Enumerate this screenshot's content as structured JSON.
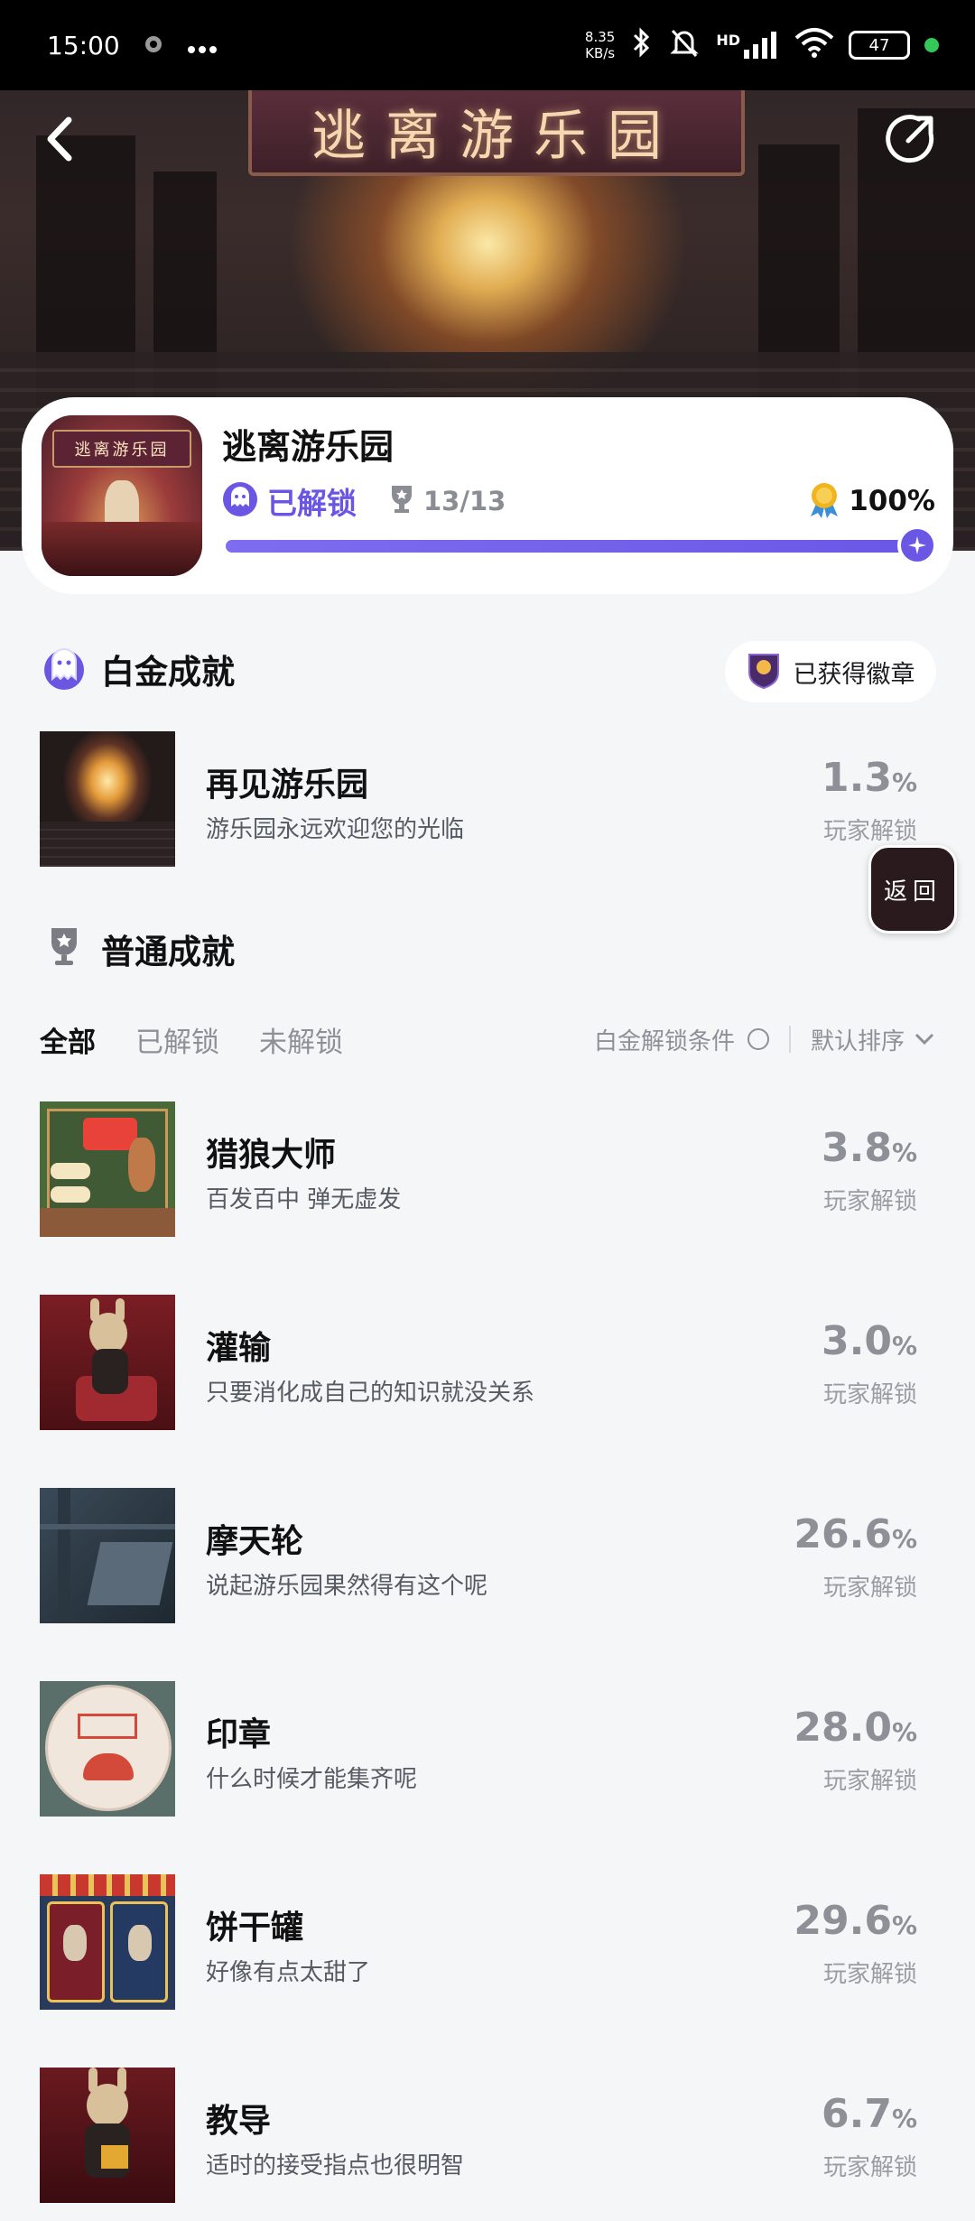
{
  "status_bar": {
    "time": "15:00",
    "net_speed_top": "8.35",
    "net_speed_unit": "KB/s",
    "signal_label": "HD",
    "battery": "47"
  },
  "hero": {
    "sign_text": "逃离游乐园"
  },
  "game": {
    "title": "逃离游乐园",
    "cover_banner": "逃离游乐园",
    "unlocked_label": "已解锁",
    "trophy_count": "13/13",
    "completion": "100%",
    "progress_fraction": 1.0
  },
  "platinum": {
    "title": "白金成就",
    "badge_label": "已获得徽章",
    "item": {
      "name": "再见游乐园",
      "desc": "游乐园永远欢迎您的光临",
      "rate": "1.3",
      "unit": "%",
      "rate_label": "玩家解锁"
    }
  },
  "normal": {
    "title": "普通成就",
    "tabs": [
      "全部",
      "已解锁",
      "未解锁"
    ],
    "condition_label": "白金解锁条件",
    "sort_label": "默认排序",
    "items": [
      {
        "name": "猎狼大师",
        "desc": "百发百中 弹无虚发",
        "rate": "3.8",
        "unit": "%",
        "rate_label": "玩家解锁"
      },
      {
        "name": "灌输",
        "desc": "只要消化成自己的知识就没关系",
        "rate": "3.0",
        "unit": "%",
        "rate_label": "玩家解锁"
      },
      {
        "name": "摩天轮",
        "desc": "说起游乐园果然得有这个呢",
        "rate": "26.6",
        "unit": "%",
        "rate_label": "玩家解锁"
      },
      {
        "name": "印章",
        "desc": "什么时候才能集齐呢",
        "rate": "28.0",
        "unit": "%",
        "rate_label": "玩家解锁"
      },
      {
        "name": "饼干罐",
        "desc": "好像有点太甜了",
        "rate": "29.6",
        "unit": "%",
        "rate_label": "玩家解锁"
      },
      {
        "name": "教导",
        "desc": "适时的接受指点也很明智",
        "rate": "6.7",
        "unit": "%",
        "rate_label": "玩家解锁"
      }
    ]
  },
  "float_button": {
    "label": "返回"
  }
}
